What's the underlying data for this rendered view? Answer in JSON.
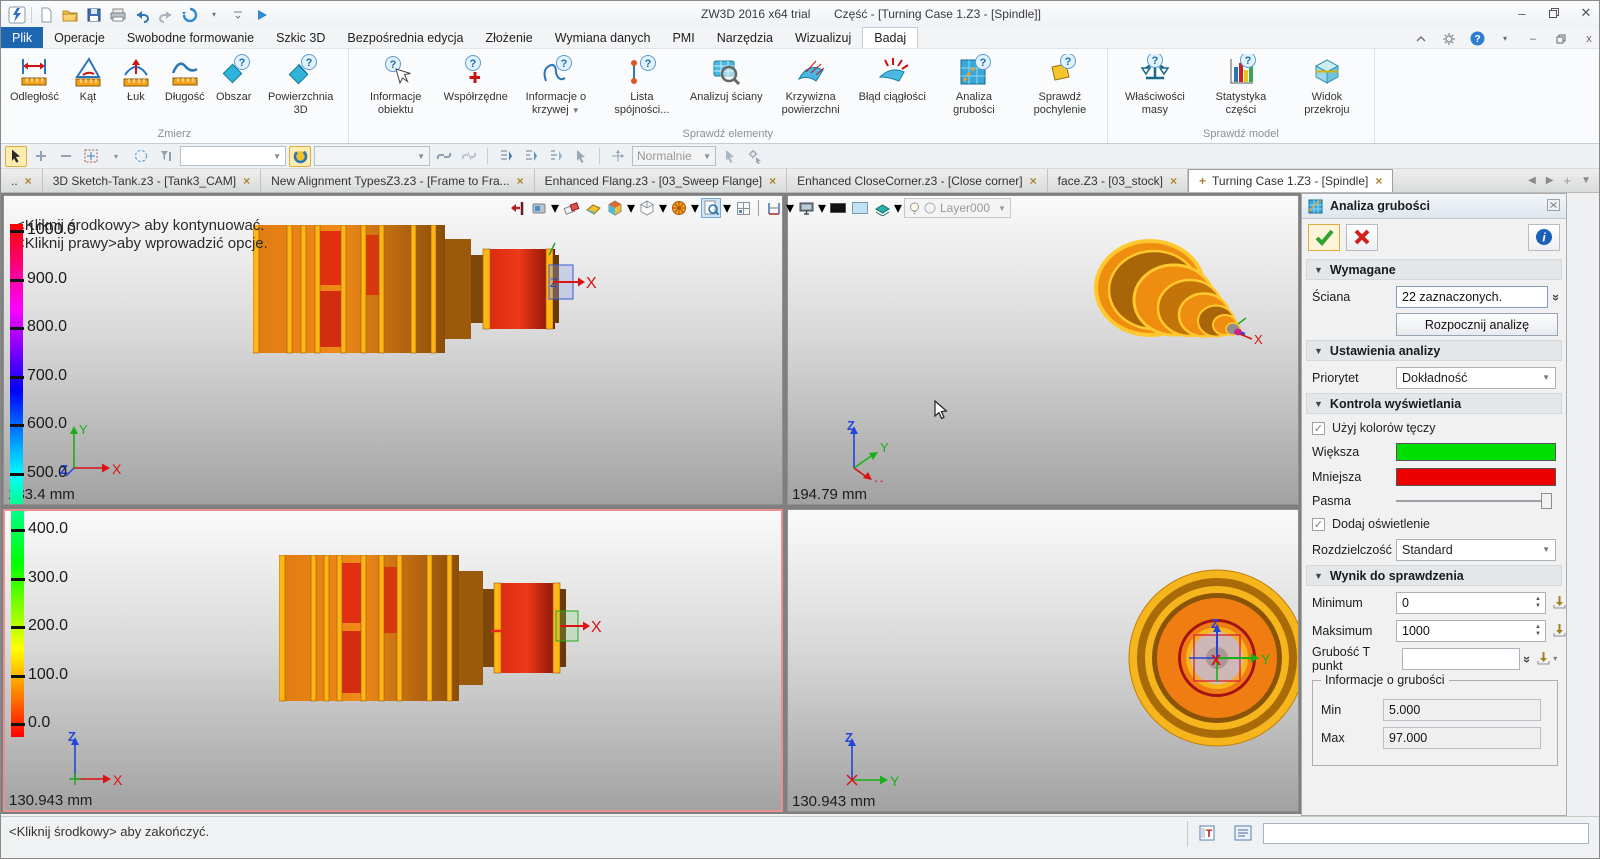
{
  "titlebar": {
    "app_title": "ZW3D 2016  x64 trial",
    "doc_title": "Część - [Turning Case 1.Z3 - [Spindle]]"
  },
  "menu_tabs": [
    {
      "label": "Plik",
      "style": "file"
    },
    {
      "label": "Operacje"
    },
    {
      "label": "Swobodne formowanie"
    },
    {
      "label": "Szkic 3D"
    },
    {
      "label": "Bezpośrednia edycja"
    },
    {
      "label": "Złożenie"
    },
    {
      "label": "Wymiana danych"
    },
    {
      "label": "PMI"
    },
    {
      "label": "Narzędzia"
    },
    {
      "label": "Wizualizuj"
    },
    {
      "label": "Badaj",
      "style": "active"
    }
  ],
  "ribbon_groups": [
    {
      "label": "Zmierz",
      "buttons": [
        {
          "label": "Odległość",
          "icon": "distance"
        },
        {
          "label": "Kąt",
          "icon": "angle"
        },
        {
          "label": "Łuk",
          "icon": "arc"
        },
        {
          "label": "Długość",
          "icon": "length"
        },
        {
          "label": "Obszar",
          "icon": "area"
        },
        {
          "label": "Powierzchnia 3D",
          "icon": "surface3d"
        }
      ]
    },
    {
      "label": "Sprawdź elementy",
      "buttons": [
        {
          "label": "Informacje obiektu",
          "icon": "info-object"
        },
        {
          "label": "Współrzędne",
          "icon": "coordinates"
        },
        {
          "label": "Informacje o krzywej",
          "icon": "curve-info",
          "dropdown": true
        },
        {
          "label": "Lista spójności...",
          "icon": "connectivity-list"
        },
        {
          "label": "Analizuj ściany",
          "icon": "analyze-faces"
        },
        {
          "label": "Krzywizna powierzchni",
          "icon": "surface-curvature"
        },
        {
          "label": "Błąd ciągłości",
          "icon": "continuity-error"
        },
        {
          "label": "Analiza grubości",
          "icon": "thickness-analysis"
        },
        {
          "label": "Sprawdź pochylenie",
          "icon": "draft-check"
        }
      ]
    },
    {
      "label": "Sprawdź model",
      "buttons": [
        {
          "label": "Właściwości masy",
          "icon": "mass-properties"
        },
        {
          "label": "Statystyka części",
          "icon": "part-statistics"
        },
        {
          "label": "Widok przekroju",
          "icon": "section-view"
        }
      ]
    }
  ],
  "toolbar": {
    "view_mode": "Normalnie",
    "layer": "Layer000"
  },
  "document_tabs": [
    {
      "label": "..",
      "active": false
    },
    {
      "label": "3D Sketch-Tank.z3 - [Tank3_CAM]",
      "active": false
    },
    {
      "label": "New Alignment TypesZ3.z3 - [Frame to Fra...",
      "active": false
    },
    {
      "label": "Enhanced Flang.z3 - [03_Sweep Flange]",
      "active": false
    },
    {
      "label": "Enhanced CloseCorner.z3 - [Close corner]",
      "active": false
    },
    {
      "label": "face.Z3 - [03_stock]",
      "active": false
    },
    {
      "label": "Turning Case 1.Z3 - [Spindle]",
      "active": true
    }
  ],
  "viewports": {
    "top_left": {
      "prompt_line1": "<Kliknij środkowy> aby kontynuować.",
      "prompt_line2": "<Kliknij prawy>aby wprowadzić opcje.",
      "ruler_label": "133.4 mm",
      "scale_ticks": [
        "1000.0",
        "900.0",
        "800.0",
        "700.0",
        "600.0",
        "500.0"
      ]
    },
    "top_right": {
      "ruler_label": "194.79 mm"
    },
    "bottom_left": {
      "ruler_label": "130.943 mm",
      "scale_ticks": [
        "400.0",
        "300.0",
        "200.0",
        "100.0",
        "0.0"
      ]
    },
    "bottom_right": {
      "ruler_label": "130.943 mm"
    }
  },
  "panel": {
    "title": "Analiza grubości",
    "section_wymagane": "Wymagane",
    "sciana_label": "Ściana",
    "sciana_value": "22 zaznaczonych.",
    "analyze_button": "Rozpocznij analizę",
    "section_ustawienia": "Ustawienia analizy",
    "priorytet_label": "Priorytet",
    "priorytet_value": "Dokładność",
    "section_kontrola": "Kontrola wyświetlania",
    "rainbow_checkbox": "Użyj kolorów tęczy",
    "wieksza_label": "Większa",
    "mniejsza_label": "Mniejsza",
    "pasma_label": "Pasma",
    "lighting_checkbox": "Dodaj oświetlenie",
    "rozdzielczosc_label": "Rozdzielczość",
    "rozdzielczosc_value": "Standard",
    "section_wynik": "Wynik do sprawdzenia",
    "minimum_label": "Minimum",
    "minimum_value": "0",
    "maksimum_label": "Maksimum",
    "maksimum_value": "1000",
    "grubosc_label": "Grubość T punkt",
    "grubosc_value": "",
    "info_group_label": "Informacje o grubości",
    "min_label": "Min",
    "min_value": "5.000",
    "max_label": "Max",
    "max_value": "97.000",
    "colors": {
      "wieksza": "#00dd00",
      "mniejsza": "#ee0000"
    }
  },
  "statusbar": {
    "message": "<Kliknij środkowy> aby zakończyć."
  }
}
